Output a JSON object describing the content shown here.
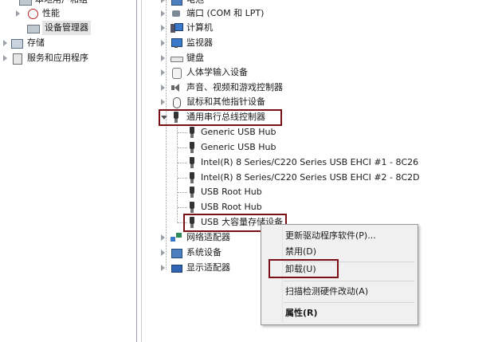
{
  "left_tree": {
    "partial_top": "本地用户和组",
    "items": [
      {
        "label": "性能",
        "icon": "performance-icon"
      },
      {
        "label": "设备管理器",
        "icon": "device-manager-icon"
      },
      {
        "label": "存储",
        "icon": "storage-icon"
      },
      {
        "label": "服务和应用程序",
        "icon": "services-icon"
      }
    ]
  },
  "device_tree": {
    "partial_top": "电池",
    "categories": [
      {
        "label": "端口 (COM 和 LPT)",
        "icon": "port-icon"
      },
      {
        "label": "计算机",
        "icon": "computer-icon"
      },
      {
        "label": "监视器",
        "icon": "monitor-icon"
      },
      {
        "label": "键盘",
        "icon": "keyboard-icon"
      },
      {
        "label": "人体学输入设备",
        "icon": "hid-icon"
      },
      {
        "label": "声音、视频和游戏控制器",
        "icon": "sound-icon"
      },
      {
        "label": "鼠标和其他指针设备",
        "icon": "mouse-icon"
      }
    ],
    "expanded_category": {
      "label": "通用串行总线控制器",
      "icon": "usb-icon"
    },
    "usb_children": [
      {
        "label": "Generic USB Hub"
      },
      {
        "label": "Generic USB Hub"
      },
      {
        "label": "Intel(R) 8 Series/C220 Series USB EHCI #1 - 8C26"
      },
      {
        "label": "Intel(R) 8 Series/C220 Series USB EHCI #2 - 8C2D"
      },
      {
        "label": "USB Root Hub"
      },
      {
        "label": "USB Root Hub"
      },
      {
        "label": "USB 大容量存储设备"
      }
    ],
    "after_categories": [
      {
        "label": "网络适配器",
        "icon": "network-icon"
      },
      {
        "label": "系统设备",
        "icon": "system-icon"
      },
      {
        "label": "显示适配器",
        "icon": "display-icon"
      }
    ]
  },
  "context_menu": {
    "items": [
      {
        "label": "更新驱动程序软件(P)...",
        "bold": false
      },
      {
        "label": "禁用(D)",
        "bold": false
      },
      {
        "label": "卸载(U)",
        "bold": false
      },
      {
        "label": "扫描检测硬件改动(A)",
        "bold": false
      },
      {
        "label": "属性(R)",
        "bold": true
      }
    ]
  },
  "colors": {
    "highlight_border": "#7a1016",
    "menu_background": "#f0f0f0"
  }
}
